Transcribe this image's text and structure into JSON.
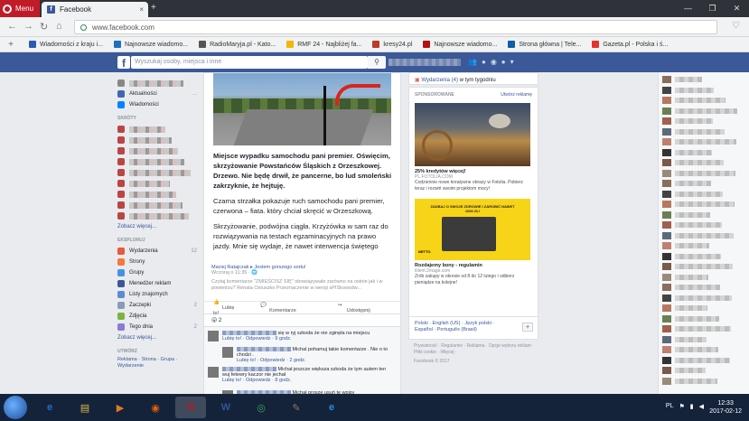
{
  "browser": {
    "menu_label": "Menu",
    "tab_title": "Facebook",
    "tab_close": "×",
    "new_tab": "+",
    "url": "www.facebook.com",
    "back": "←",
    "forward": "→",
    "reload": "↻",
    "home": "⌂",
    "window_controls": [
      "—",
      "❐",
      "✕"
    ],
    "bookmark_add": "+",
    "bookmarks": [
      {
        "label": "Wiadomości z kraju i...",
        "color": "#2a5db0"
      },
      {
        "label": "Najnowsze wiadomo...",
        "color": "#1f6fbf"
      },
      {
        "label": "RadioMaryja.pl - Kato...",
        "color": "#555555"
      },
      {
        "label": "RMF 24 - Najbliżej fa...",
        "color": "#f2b705"
      },
      {
        "label": "kresy24.pl",
        "color": "#c0392b"
      },
      {
        "label": "Najnowsze wiadomo...",
        "color": "#b11116"
      },
      {
        "label": "Strona główna | Tele...",
        "color": "#0b5fa5"
      },
      {
        "label": "Gazeta.pl - Polska i ś...",
        "color": "#e4332b"
      }
    ]
  },
  "fb": {
    "logo": "f",
    "search_placeholder": "Wyszukaj osoby, miejsca i inne",
    "search_icon": "search-icon"
  },
  "left": {
    "items_top": [
      {
        "label": "Aktualności",
        "color": "#4267b2",
        "cnt": "..."
      },
      {
        "label": "Wiadomości",
        "color": "#0084ff",
        "cnt": ""
      }
    ],
    "shortcuts_header": "SKRÓTY",
    "more1": "Zobacz więcej...",
    "explore_header": "EKSPLORUJ",
    "explore": [
      {
        "label": "Wydarzenia",
        "color": "#e9573f",
        "cnt": "12"
      },
      {
        "label": "Strony",
        "color": "#f5793a",
        "cnt": ""
      },
      {
        "label": "Grupy",
        "color": "#4a90e2",
        "cnt": ""
      },
      {
        "label": "Menedżer reklam",
        "color": "#3b5998",
        "cnt": ""
      },
      {
        "label": "Listy znajomych",
        "color": "#5b8bd6",
        "cnt": ""
      },
      {
        "label": "Zaczepki",
        "color": "#8a9bb8",
        "cnt": "2"
      },
      {
        "label": "Zdjęcia",
        "color": "#7bb33e",
        "cnt": ""
      },
      {
        "label": "Tego dnia",
        "color": "#8b7ad6",
        "cnt": "2"
      }
    ],
    "more2": "Zobacz więcej...",
    "create_header": "UTWÓRZ",
    "create_links": "Reklama · Strona · Grupa · Wydarzenie"
  },
  "post": {
    "para1": "Miejsce wypadku samochodu pani premier. Oświęcim, skrzyżowanie Powstańców Śląskich z Orzeszkowej. Drzewo. Nie będę drwił, że pancerne, bo lud smoleński zakrzyknie, że hejtuję.",
    "para2": "Czarna strzałka pokazuje ruch samochodu pani premier, czerwona – fiata. który chciał skręcić w Orzeszkową.",
    "para3": "Skrzyżowanie, podwójna ciągła. Krzyżówka w sam raz do rozwiązywania na testach egzaminacyjnych na prawo jazdy. Mnie się wydaje, że nawet interwencja świętego",
    "author": "Maciej Ratajczak",
    "author_suffix": "Jestem gorszego sortu!",
    "time": "Wczoraj o 11:35 · 🌐",
    "desc": "Czytaj komentarze \"ZMIEŚCISZ SIĘ\" obowiązywało zarówno na ostnie jak i w powietrzu? Renata Ostuszko Przeznaczenie w wersji sPISkowsdw...",
    "like": "Lubię to!",
    "comment": "Komentarze",
    "share": "Udostępnij",
    "reactions": "😮 2"
  },
  "comments": [
    {
      "text": "się w ryj szkoda że nie zginęła na miejscu",
      "meta": "Lubię to! · Odpowiedz · 9 godz."
    },
    {
      "text": "Michal pohamuj takie komentarze . Nie o to chodzi .",
      "meta": "Lubię to! · Odpowiedz · 2 godz."
    },
    {
      "text": "Michał jeszcze większa szkoda że tym autem ten wuj fetewry kaczor nie jechał",
      "meta": "Lubię to! · Odpowiedz · 8 godz."
    },
    {
      "text": "Michał proszę usuń te wpisy",
      "meta": ""
    }
  ],
  "right": {
    "events_label": "Wydarzenia (4)",
    "events_suffix": "w tym tygodniu",
    "sponsored": "SPONSOROWANE",
    "create_ad": "Utwórz reklamę",
    "ad1_title": "25% kredytów więcej!",
    "ad1_domain": "PL.FOTOLIA.COM",
    "ad1_text": "Codziennie nowe kreatywne obrazy w Fotolia. Pobierz teraz i rozwiń swoim projektom mocy!",
    "ad2_img_text": "ZADBAJ O SWOJE ZDROWIE I ZAROBIĆ NAWET 1000 ZŁ!",
    "ad2_tag": "NETTO",
    "ad2_title": "Rozdajemy bony - regulamin",
    "ad2_domain": "klient.2mage.com",
    "ad2_text": "Zrób zakupy w okresie od 8 do 12 lutego i odbierz pieniądze na kolejne!",
    "lang_line1": "Polski · English (US) · Język polski ·",
    "lang_line2": "Español · Português (Brasil)",
    "lang_add": "+",
    "footer": "Prywatność · Regulamin · Reklama · Opcje wyboru reklam · Pliki cookie · Więcej ·",
    "copyright": "Facebook © 2017"
  },
  "taskbar": {
    "time": "12:33",
    "date": "2017-02-12",
    "lang": "PL",
    "apps": [
      {
        "name": "ie",
        "glyph": "e",
        "color": "#1e6fd0"
      },
      {
        "name": "folder",
        "glyph": "▤",
        "color": "#e1b84a"
      },
      {
        "name": "media",
        "glyph": "▶",
        "color": "#e07a1f"
      },
      {
        "name": "firefox",
        "glyph": "◉",
        "color": "#e66000"
      },
      {
        "name": "opera",
        "glyph": "O",
        "color": "#cc0f16"
      },
      {
        "name": "word",
        "glyph": "W",
        "color": "#2b579a"
      },
      {
        "name": "chrome",
        "glyph": "◎",
        "color": "#34a853"
      },
      {
        "name": "paint",
        "glyph": "✎",
        "color": "#8a7a5a"
      },
      {
        "name": "edge",
        "glyph": "e",
        "color": "#1e8fe0"
      }
    ]
  }
}
